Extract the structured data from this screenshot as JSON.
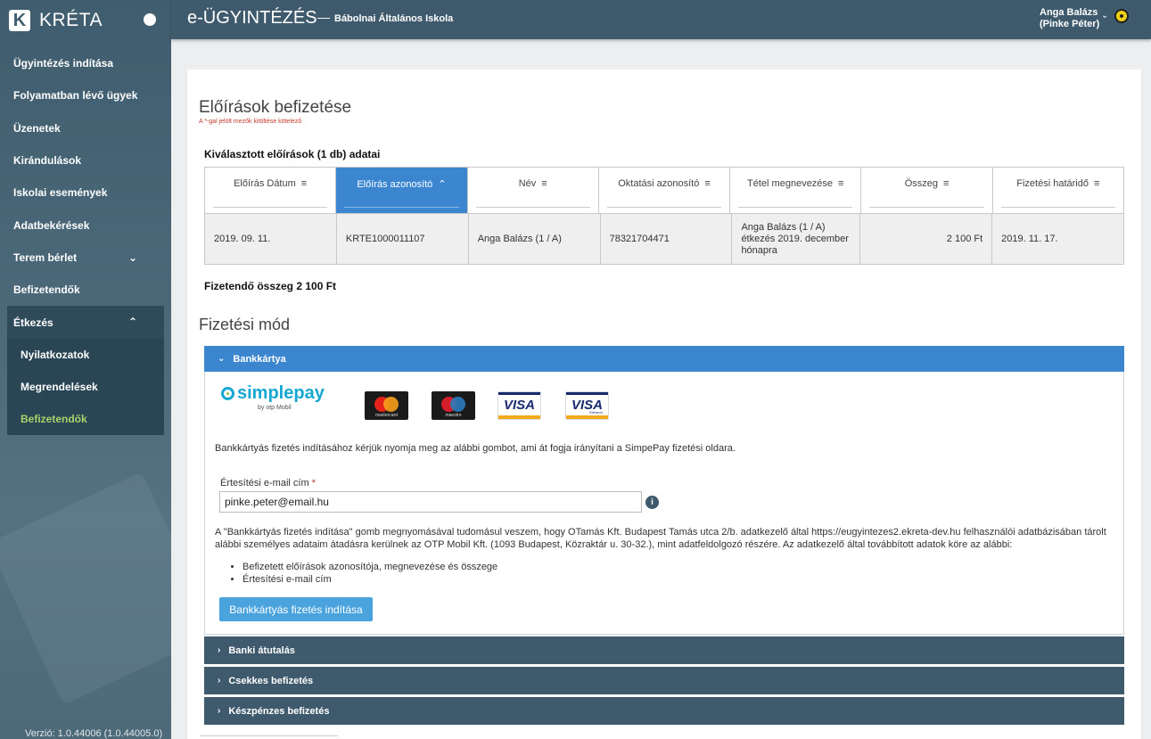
{
  "app": {
    "logo_mark": "K",
    "logo_text": "KRÉTA",
    "title": "e-ÜGYINTÉZÉS",
    "dash": "—",
    "school": "Bábolnai Általános Iskola",
    "user_line1": "Anga Balázs",
    "user_line2": "(Pinke Péter)",
    "user_chevron": "⌄",
    "version": "Verzió: 1.0.44006 (1.0.44005.0)"
  },
  "sidebar": {
    "items": [
      {
        "label": "Ügyintézés indítása"
      },
      {
        "label": "Folyamatban lévő ügyek"
      },
      {
        "label": "Üzenetek"
      },
      {
        "label": "Kirándulások"
      },
      {
        "label": "Iskolai események"
      },
      {
        "label": "Adatbekérések"
      },
      {
        "label": "Terem bérlet",
        "chevron": "⌄"
      },
      {
        "label": "Befizetendők"
      }
    ],
    "group": {
      "label": "Étkezés",
      "chevron": "⌃",
      "subitems": [
        {
          "label": "Nyilatkozatok"
        },
        {
          "label": "Megrendelések"
        },
        {
          "label": "Befizetendők"
        }
      ]
    }
  },
  "page": {
    "title": "Előírások befizetése",
    "required_note": "A *-gal jelölt mezők kitöltése kötelező",
    "section_title": "Kiválasztott előírások (1 db) adatai",
    "total": "Fizetendő összeg 2 100 Ft",
    "payment_title": "Fizetési mód"
  },
  "table": {
    "filter_icon": "≡",
    "sort_icon": "⌃",
    "columns": [
      {
        "label": "Előírás Dátum"
      },
      {
        "label": "Előírás azonosító"
      },
      {
        "label": "Név"
      },
      {
        "label": "Oktatási azonosító"
      },
      {
        "label": "Tétel megnevezése"
      },
      {
        "label": "Összeg"
      },
      {
        "label": "Fizetési határidő"
      }
    ],
    "rows": [
      {
        "cells": [
          "2019. 09. 11.",
          "KRTE1000011107",
          "Anga Balázs (1 / A)",
          "78321704471",
          "Anga Balázs (1 / A) étkezés 2019. december hónapra",
          "2 100 Ft",
          "2019. 11. 17."
        ]
      }
    ]
  },
  "payment": {
    "card": {
      "header": "Bankkártya",
      "arrow": "⌄",
      "simplepay": "simplepay",
      "simplepay_sub": "by otp Mobil",
      "mastercard": "mastercard",
      "maestro": "maestro",
      "visa1": "VISA",
      "visa2": "VISA",
      "visa2_sub": "Electron",
      "info": "Bankkártyás fizetés indításához kérjük nyomja meg az alábbi gombot, ami át fogja irányítani a SimpePay fizetési oldara.",
      "email_label": "Értesítési e-mail cím",
      "email_required": "*",
      "email_value": "pinke.peter@email.hu",
      "info_icon": "i",
      "consent": "A \"Bankkártyás fizetés indítása\" gomb megnyomásával tudomásul veszem, hogy OTamás Kft. Budapest Tamás utca 2/b. adatkezelő által https://eugyintezes2.ekreta-dev.hu felhasználói adatbázisában tárolt alábbi személyes adataim átadásra kerülnek az OTP Mobil Kft. (1093 Budapest, Közraktár u. 30-32.), mint adatfeldolgozó részére. Az adatkezelő által továbbított adatok köre az alábbi:",
      "bullets": [
        "Befizetett előírások azonosítója, megnevezése és összege",
        "Értesítési e-mail cím"
      ],
      "button": "Bankkártyás fizetés indítása"
    },
    "closed": [
      {
        "label": "Banki átutalás",
        "arrow": "›"
      },
      {
        "label": "Csekkes befizetés",
        "arrow": "›"
      },
      {
        "label": "Készpénzes befizetés",
        "arrow": "›"
      }
    ]
  },
  "colors": {
    "sidebar": "#3f5d6e",
    "header": "#3e5a6c",
    "accent_blue": "#3b86cf",
    "button_blue": "#4aa3dd",
    "active_green": "#a7d36a"
  }
}
